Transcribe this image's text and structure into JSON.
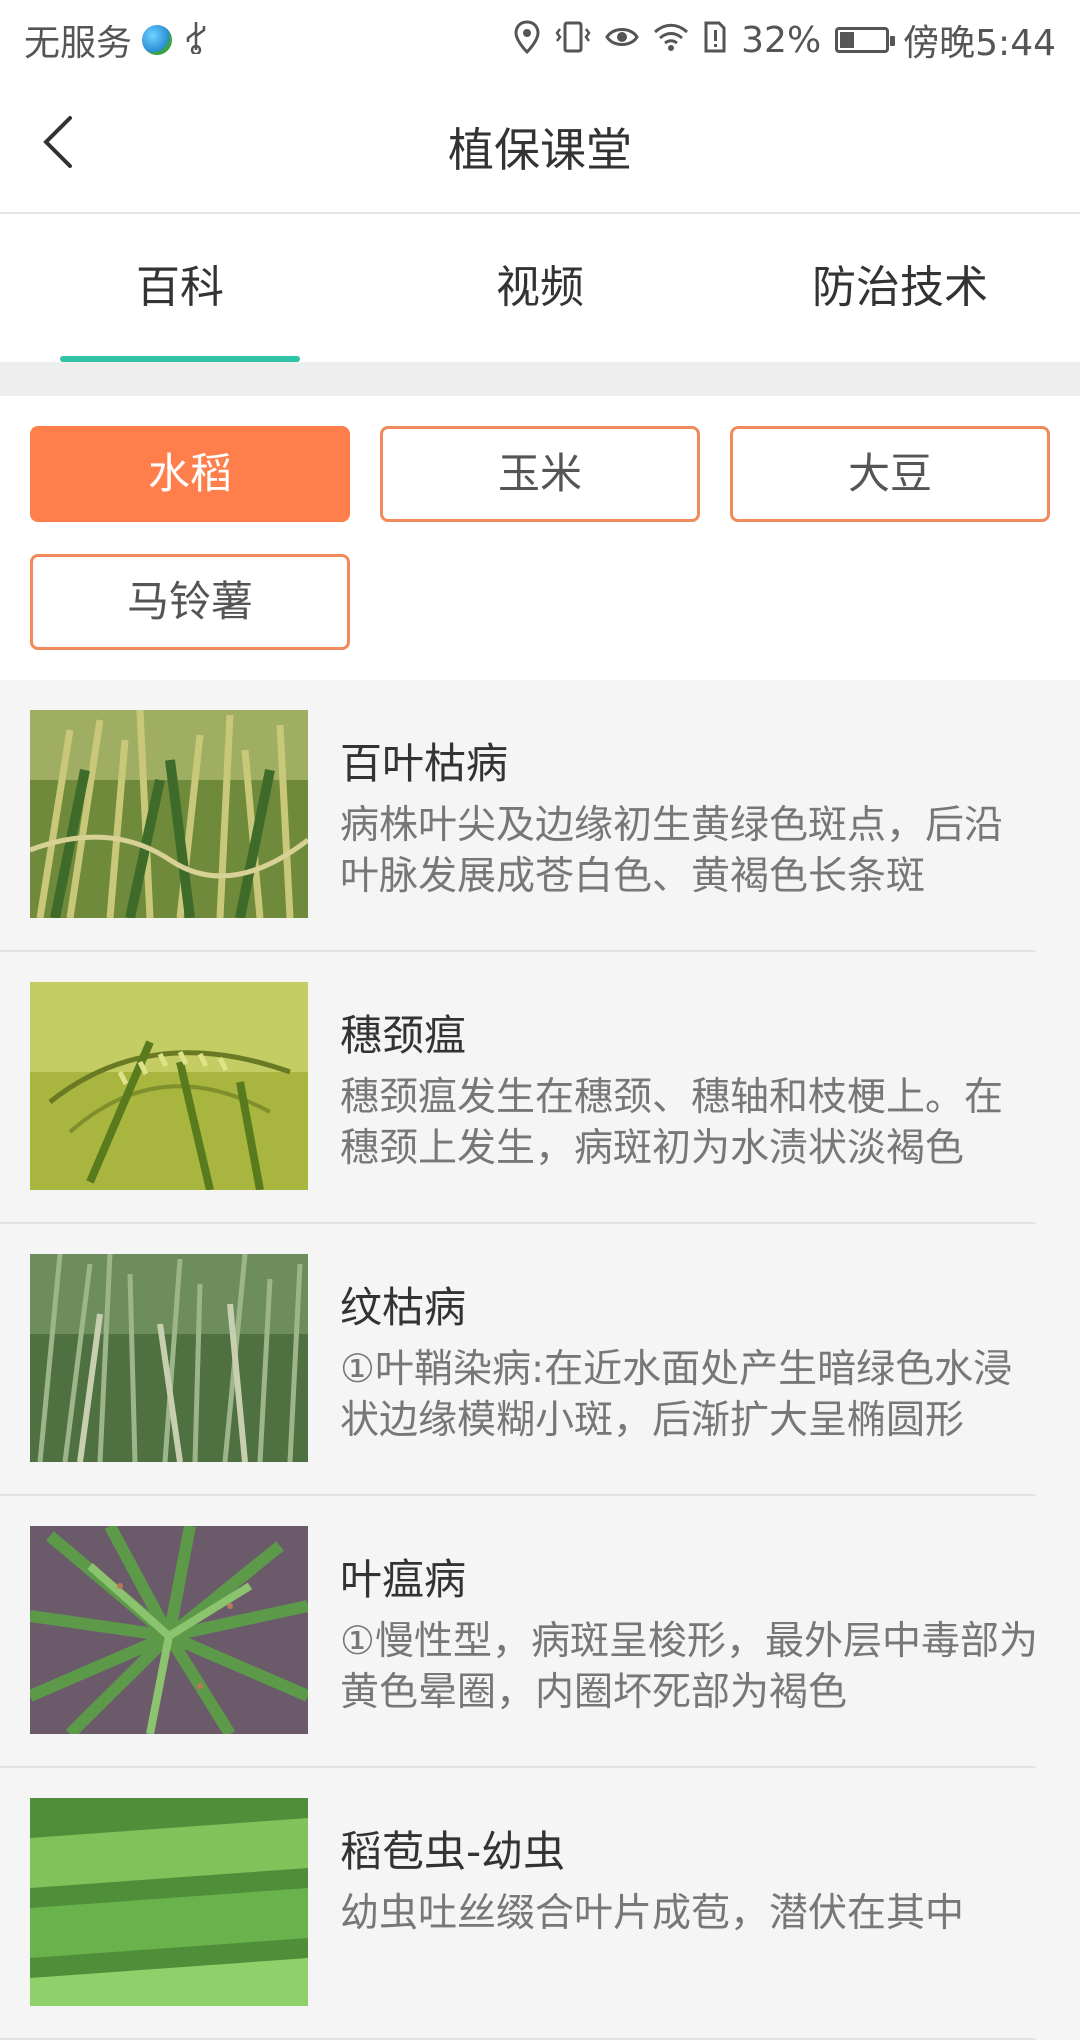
{
  "status_bar": {
    "carrier": "无服务",
    "battery_percent": "32%",
    "time": "傍晚5:44",
    "battery_level": 0.32,
    "icons": [
      "globe-icon",
      "usb-icon",
      "location-icon",
      "vibrate-icon",
      "eye-icon",
      "wifi-icon",
      "sim-alert-icon",
      "battery-icon"
    ]
  },
  "header": {
    "title": "植保课堂",
    "back_icon": "chevron-left-icon"
  },
  "tabs": [
    {
      "label": "百科",
      "active": true
    },
    {
      "label": "视频",
      "active": false
    },
    {
      "label": "防治技术",
      "active": false
    }
  ],
  "crops": [
    {
      "label": "水稻",
      "active": true
    },
    {
      "label": "玉米",
      "active": false
    },
    {
      "label": "大豆",
      "active": false
    },
    {
      "label": "马铃薯",
      "active": false
    }
  ],
  "articles": [
    {
      "title": "百叶枯病",
      "desc": "病株叶尖及边缘初生黄绿色斑点，后沿叶脉发展成苍白色、黄褐色长条斑"
    },
    {
      "title": "穗颈瘟",
      "desc": " 穗颈瘟发生在穗颈、穗轴和枝梗上。在穗颈上发生，病斑初为水渍状淡褐色"
    },
    {
      "title": "纹枯病",
      "desc": "①叶鞘染病:在近水面处产生暗绿色水浸状边缘模糊小斑，后渐扩大呈椭圆形"
    },
    {
      "title": "叶瘟病",
      "desc": "①慢性型，病斑呈梭形，最外层中毒部为黄色晕圈，内圈坏死部为褐色"
    },
    {
      "title": "稻苞虫-幼虫",
      "desc": "幼虫吐丝缀合叶片成苞，潜伏在其中"
    }
  ],
  "colors": {
    "accent_tab": "#2fc2a5",
    "chip_active": "#ff7f4c",
    "chip_border": "#f08a5a"
  }
}
